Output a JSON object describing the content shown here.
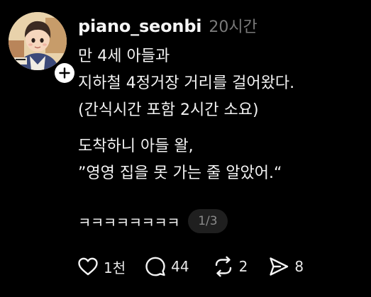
{
  "post": {
    "username": "piano_seonbi",
    "time": "20시간",
    "body_lines": [
      "만 4세 아들과",
      "지하철 4정거장 거리를 걸어왔다.",
      "(간식시간 포함 2시간 소요)",
      "",
      "도착하니 아들 왈,",
      "”영영 집을 못 가는 줄 알았어.“"
    ],
    "laugh_text": "ㅋㅋㅋㅋㅋㅋㅋㅋ",
    "page_indicator": "1/3"
  },
  "actions": {
    "like_count": "1천",
    "reply_count": "44",
    "repost_count": "2",
    "share_count": "8"
  },
  "icons": {
    "follow": "plus-icon",
    "like": "heart-icon",
    "reply": "comment-bubble-icon",
    "repost": "repost-arrows-icon",
    "share": "send-arrow-icon"
  },
  "colors": {
    "background": "#000000",
    "text": "#f3f3f3",
    "muted": "#7a7a7a",
    "pill_bg": "#1f1f1f"
  }
}
